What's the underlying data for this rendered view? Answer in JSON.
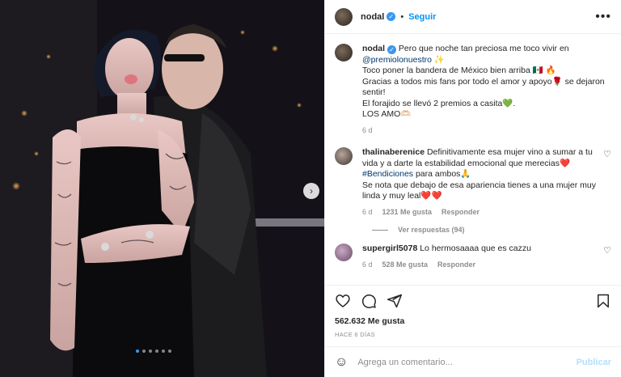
{
  "header": {
    "username": "nodal",
    "separator": "•",
    "follow_label": "Seguir",
    "more_label": "•••"
  },
  "caption": {
    "username": "nodal",
    "lines": [
      "Pero que noche tan preciosa me toco vivir en",
      "@premiolonuestro ✨",
      "Toco poner la bandera de México bien arriba 🇲🇽 🔥",
      "Gracias a todos mis fans por todo el amor y apoyo🌹 se dejaron sentir!",
      "El forajido se llevó 2 premios a casita💚.",
      "LOS AMO🫶🏻"
    ],
    "time": "6 d"
  },
  "comments": [
    {
      "username": "thalinaberenice",
      "text_1": "Definitivamente esa mujer vino a sumar a tu vida y a darte la estabilidad emocional que merecias❤️",
      "hashtag": "#Bendiciones",
      "text_2": " para ambos🙏",
      "text_3": "Se nota que debajo de esa apariencia tienes a una mujer muy linda y muy leal❤️❤️",
      "time": "6 d",
      "likes": "1231 Me gusta",
      "reply": "Responder",
      "view_replies": "Ver respuestas (94)"
    },
    {
      "username": "supergirl5078",
      "text": "Lo hermosaaaa que es cazzu",
      "time": "6 d",
      "likes": "528 Me gusta",
      "reply": "Responder"
    }
  ],
  "stats": {
    "likes": "562.632 Me gusta",
    "ago": "HACE 6 DÍAS"
  },
  "composer": {
    "placeholder": "Agrega un comentario...",
    "publish_label": "Publicar"
  },
  "carousel": {
    "total_slides": 6,
    "active_index": 0,
    "next_label": "›"
  },
  "colors": {
    "accent": "#0095f6",
    "verified": "#3897f0",
    "muted": "#8e8e8e"
  }
}
